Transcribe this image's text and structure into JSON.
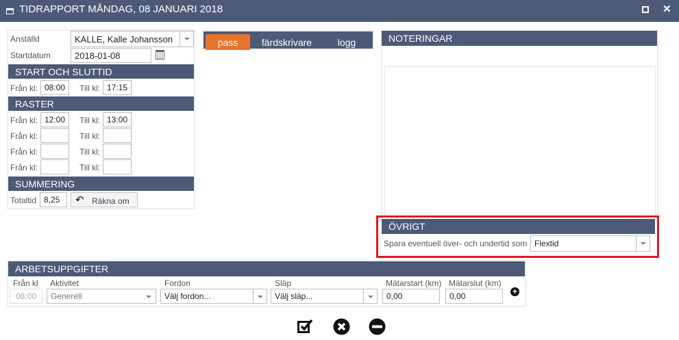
{
  "window": {
    "title": "TIDRAPPORT MÅNDAG, 08 JANUARI 2018"
  },
  "employee": {
    "label": "Anställd",
    "value": "KALLE, Kalle Johansson"
  },
  "startdate": {
    "label": "Startdatum",
    "value": "2018-01-08"
  },
  "start_end": {
    "title": "START OCH SLUTTID",
    "from_label": "Från kl:",
    "to_label": "Till kl:",
    "from": "08:00",
    "to": "17:15"
  },
  "breaks": {
    "title": "RASTER",
    "from_label": "Från kl:",
    "to_label": "Till kl:",
    "rows": [
      {
        "from": "12:00",
        "to": "13:00"
      },
      {
        "from": "",
        "to": ""
      },
      {
        "from": "",
        "to": ""
      },
      {
        "from": "",
        "to": ""
      }
    ]
  },
  "summary": {
    "title": "SUMMERING",
    "total_label": "Totaltid",
    "total": "8,25",
    "recalc_label": "Räkna om"
  },
  "tabs": [
    {
      "label": "pass",
      "active": true
    },
    {
      "label": "färdskrivare"
    },
    {
      "label": "logg"
    }
  ],
  "notes": {
    "title": "NOTERINGAR",
    "value": ""
  },
  "other": {
    "title": "ÖVRIGT",
    "label": "Spara eventuell över- och undertid som",
    "value": "Flextid"
  },
  "tasks": {
    "title": "ARBETSUPPGIFTER",
    "cols": {
      "from": "Från kl",
      "activity": "Aktivitet",
      "vehicle": "Fordon",
      "trailer": "Släp",
      "meter_start": "Mätarstart (km)",
      "meter_end": "Mätarslut (km)"
    },
    "row": {
      "from": "08:00",
      "activity": "Generell",
      "vehicle": "Välj fordon...",
      "trailer": "Välj släp...",
      "meter_start": "0,00",
      "meter_end": "0,00"
    }
  },
  "colors": {
    "header": "#4c5a78",
    "tab_active": "#e8732a",
    "highlight": "#e3161f"
  }
}
